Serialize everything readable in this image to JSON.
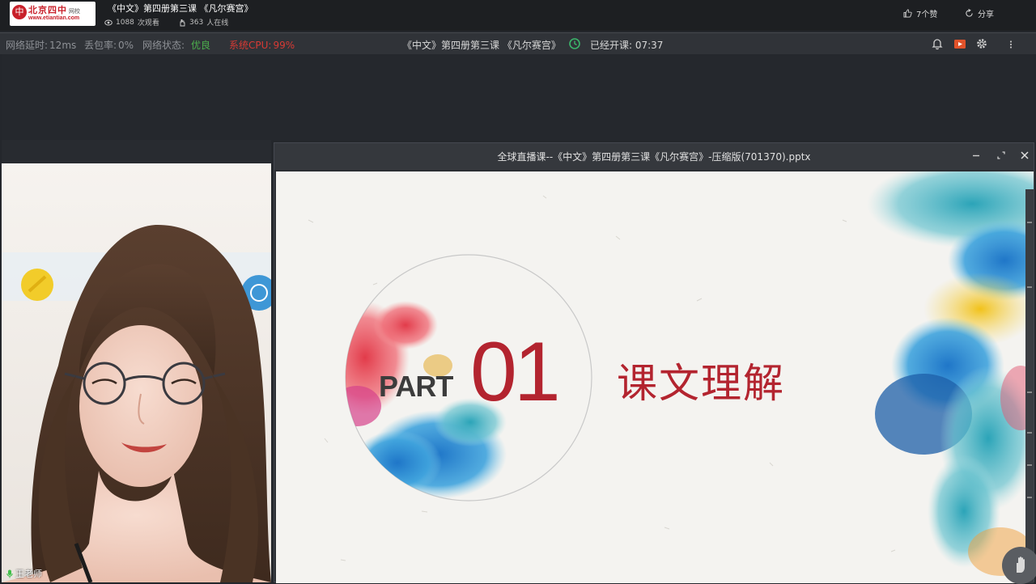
{
  "header": {
    "logo": {
      "name_cn": "北京四中",
      "name_suffix": "网校",
      "url": "www.etiantian.com"
    },
    "live_title": "《中文》第四册第三课 《凡尔赛宫》",
    "views": {
      "count": "1088",
      "label": "次观看"
    },
    "online": {
      "count": "363",
      "label": "人在线"
    },
    "like_label": "7个赞",
    "share_label": "分享"
  },
  "statusbar": {
    "latency": {
      "label": "网络延时:",
      "value": "12ms"
    },
    "packet_loss": {
      "label": "丢包率:",
      "value": "0%"
    },
    "network": {
      "label": "网络状态:",
      "value": "优良"
    },
    "cpu": {
      "label": "系统CPU:",
      "value": "99%"
    },
    "course_title": "《中文》第四册第三课 《凡尔赛宫》",
    "elapsed": "已经开课: 07:37",
    "icons": [
      "bell-icon",
      "video-icon",
      "gear-icon",
      "more-icon"
    ]
  },
  "teacher": {
    "name": "王老师"
  },
  "document": {
    "title": "全球直播课--《中文》第四册第三课《凡尔赛宫》-压缩版(701370).pptx",
    "slide": {
      "part_word": "PART",
      "part_number": "01",
      "section_title": "课文理解"
    }
  },
  "colors": {
    "accent_red": "#b3242f",
    "good_green": "#4cb04c",
    "warn_red": "#d83a34"
  }
}
